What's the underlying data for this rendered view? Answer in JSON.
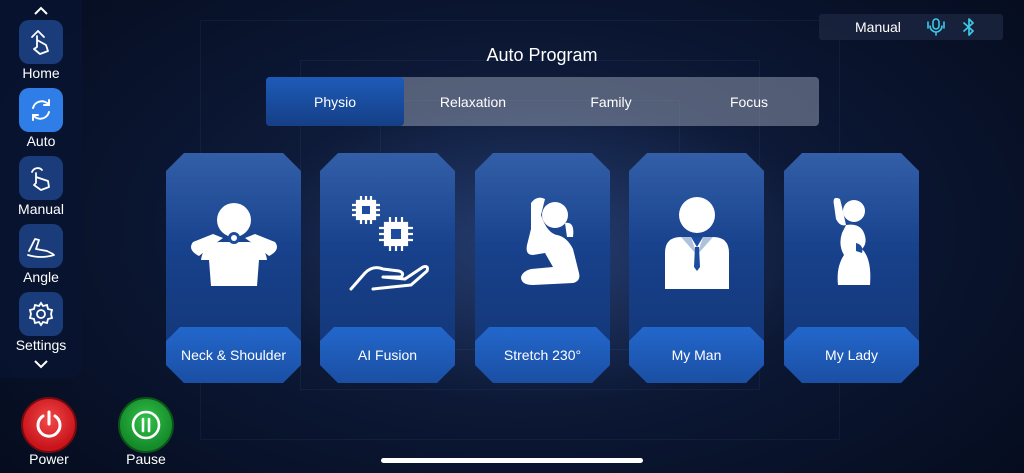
{
  "sidebar": {
    "items": [
      {
        "label": "Home",
        "icon": "hand-press-icon",
        "active": false
      },
      {
        "label": "Auto",
        "icon": "sync-icon",
        "active": true
      },
      {
        "label": "Manual",
        "icon": "hand-touch-icon",
        "active": false
      },
      {
        "label": "Angle",
        "icon": "recline-angle-icon",
        "active": false
      },
      {
        "label": "Settings",
        "icon": "gear-icon",
        "active": false
      }
    ]
  },
  "controls": {
    "power_label": "Power",
    "pause_label": "Pause"
  },
  "status": {
    "mode_text": "Manual",
    "icons": [
      "voice-icon",
      "bluetooth-icon"
    ]
  },
  "page_title": "Auto Program",
  "tabs": [
    {
      "label": "Physio",
      "active": true
    },
    {
      "label": "Relaxation",
      "active": false
    },
    {
      "label": "Family",
      "active": false
    },
    {
      "label": "Focus",
      "active": false
    }
  ],
  "programs": [
    {
      "label": "Neck & Shoulder",
      "icon": "neck-shoulder-icon"
    },
    {
      "label": "AI Fusion",
      "icon": "ai-chip-hand-icon"
    },
    {
      "label": "Stretch 230°",
      "icon": "stretch-pose-icon"
    },
    {
      "label": "My Man",
      "icon": "man-figure-icon"
    },
    {
      "label": "My Lady",
      "icon": "lady-figure-icon"
    }
  ],
  "colors": {
    "accent": "#2f7de6",
    "power": "#d01a22",
    "pause": "#1fa335",
    "status_icon": "#3cc8e6"
  }
}
